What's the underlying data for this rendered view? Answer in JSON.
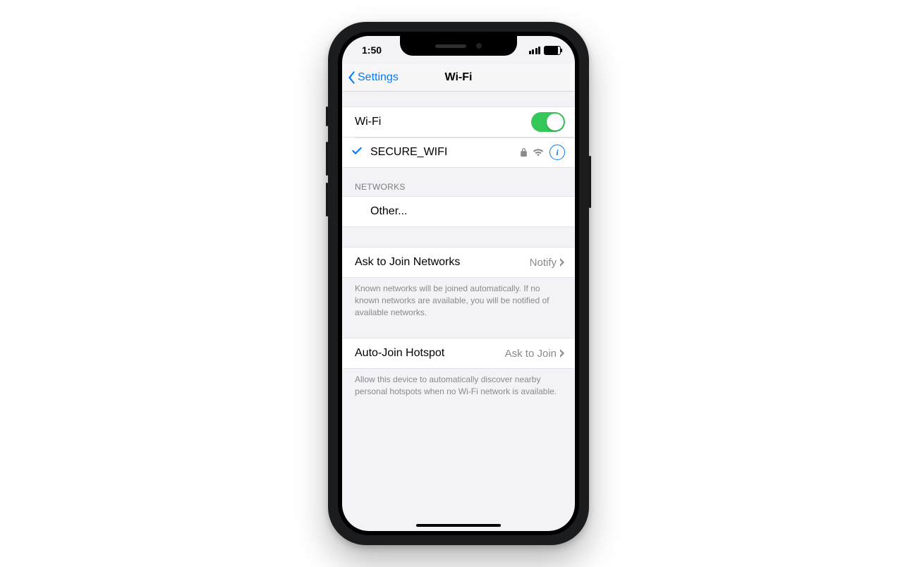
{
  "status_bar": {
    "time": "1:50"
  },
  "nav": {
    "back_label": "Settings",
    "title": "Wi-Fi"
  },
  "wifi": {
    "toggle_label": "Wi-Fi",
    "toggle_on": true,
    "connected_name": "SECURE_WIFI"
  },
  "networks": {
    "header": "NETWORKS",
    "other_label": "Other..."
  },
  "ask_join": {
    "label": "Ask to Join Networks",
    "value": "Notify",
    "footer": "Known networks will be joined automatically. If no known networks are available, you will be notified of available networks."
  },
  "auto_hotspot": {
    "label": "Auto-Join Hotspot",
    "value": "Ask to Join",
    "footer": "Allow this device to automatically discover nearby personal hotspots when no Wi-Fi network is available."
  }
}
